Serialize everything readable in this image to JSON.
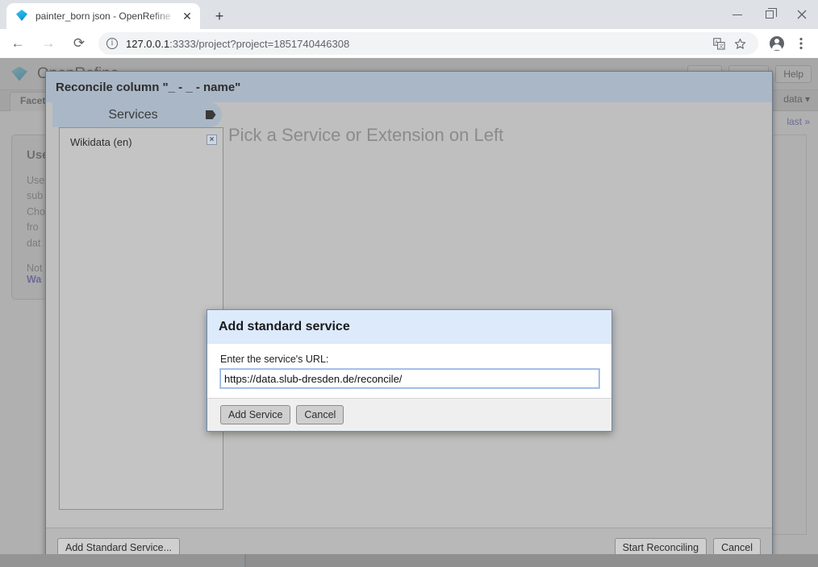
{
  "browser": {
    "tab": {
      "title": "painter_born json - OpenRefine",
      "favicon": "diamond-icon",
      "close_label": "✕"
    },
    "new_tab_label": "+",
    "window_controls": {
      "minimize": "–",
      "maximize": "❐",
      "close": "✕"
    },
    "nav": {
      "back": "←",
      "forward": "→",
      "reload": "⟳"
    },
    "omnibox": {
      "info_icon": "i",
      "url_host": "127.0.0.1",
      "url_rest": ":3333/project?project=1851740446308"
    },
    "toolbar_icons": [
      "translate-icon",
      "bookmark-star-icon",
      "profile-avatar-icon",
      "browser-menu-icon"
    ]
  },
  "refine": {
    "app_title": "OpenRefine",
    "help_button": "Help",
    "tab_facet": "Facet",
    "menu_right": "data ▾",
    "paging_last": "last »",
    "facet_help": {
      "title": "Use",
      "body": "Use\nsub\nCho\nfro\ndat",
      "note": "Not",
      "link": "Wa"
    }
  },
  "reconcile_dialog": {
    "title": "Reconcile column \"_ - _ - name\"",
    "services_tab_label": "Services",
    "services": [
      {
        "name": "Wikidata (en)",
        "remove_label": "×"
      }
    ],
    "placeholder": "Pick a Service or Extension on Left",
    "footer": {
      "add_standard_service": "Add Standard Service...",
      "start_reconciling": "Start Reconciling",
      "cancel": "Cancel"
    }
  },
  "add_service_modal": {
    "title": "Add standard service",
    "url_label": "Enter the service's URL:",
    "url_value": "https://data.slub-dresden.de/reconcile/",
    "url_placeholder": "",
    "add_button": "Add Service",
    "cancel_button": "Cancel"
  },
  "colors": {
    "modal_header": "#ddeafb",
    "dialog_titlebar": "#aab7c6",
    "accent_link": "#4b4bb5",
    "focus_border": "#8fb0e0"
  }
}
